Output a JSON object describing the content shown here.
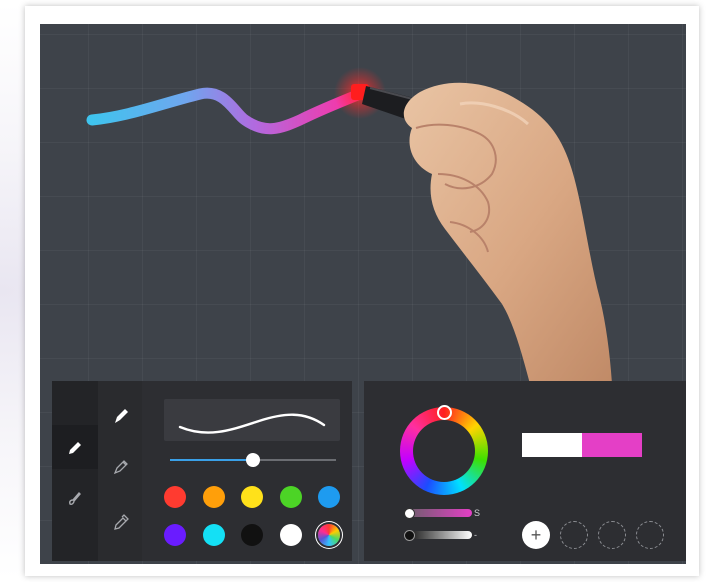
{
  "brush_panel": {
    "tools": [
      {
        "name": "pencil",
        "icon": "pencil-icon",
        "active": true
      },
      {
        "name": "brush",
        "icon": "brush-icon",
        "active": false
      }
    ],
    "pen_types": [
      {
        "name": "pen",
        "icon": "pen-nib-icon",
        "active": true
      },
      {
        "name": "marker",
        "icon": "marker-icon",
        "active": false
      },
      {
        "name": "highlighter",
        "icon": "highlighter-icon",
        "active": false
      }
    ],
    "size_level": 0.5,
    "palette": [
      "#ff3b30",
      "#ff9f0a",
      "#ffe11a",
      "#4cd426",
      "#1e9bf0",
      "#6a1cff",
      "#14e0f5",
      "#111111",
      "#ffffff"
    ],
    "color_wheel_icon": "color-wheel-icon"
  },
  "color_panel": {
    "saturation_label": "S",
    "brightness_label": "-",
    "primary_color": "#ffffff",
    "secondary_color": "#e43fc6",
    "add_label": "+",
    "empty_slots": 3
  }
}
